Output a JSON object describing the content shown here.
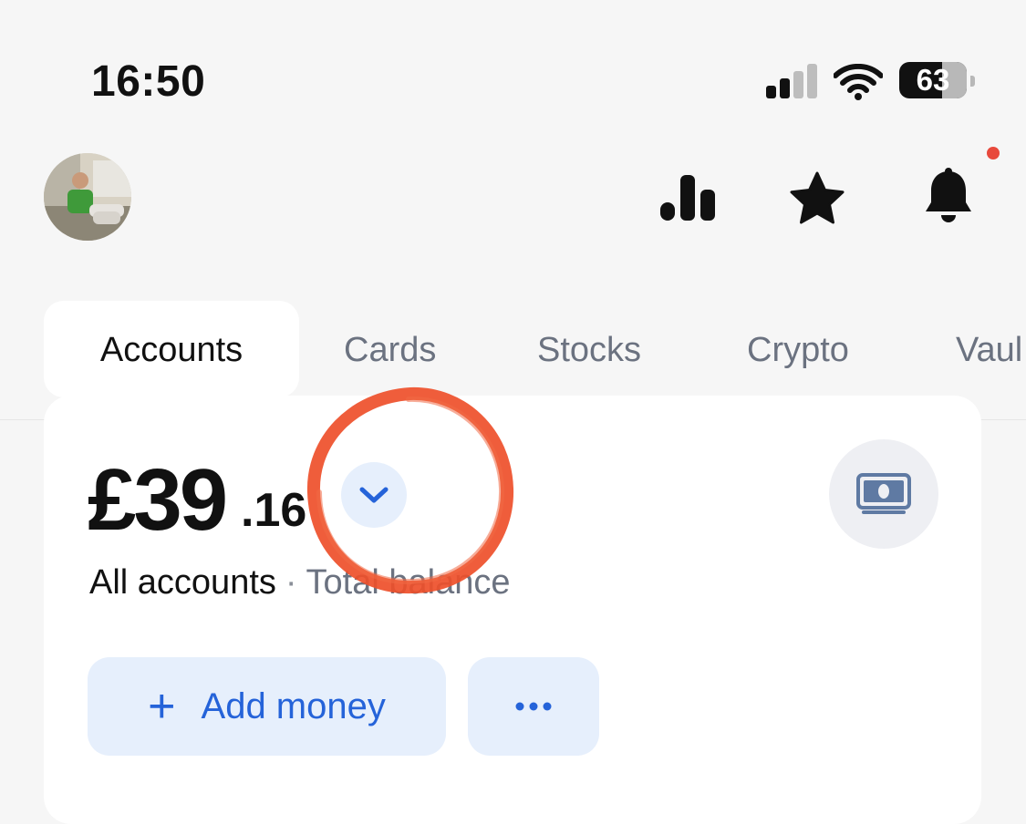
{
  "status_bar": {
    "time": "16:50",
    "battery_level": "63",
    "signal_bars_active": 2,
    "signal_bars_total": 4
  },
  "header": {
    "avatar_icon": "profile-avatar",
    "actions": [
      {
        "icon": "analytics-bars-icon"
      },
      {
        "icon": "star-icon"
      },
      {
        "icon": "bell-icon",
        "has_notification": true
      }
    ]
  },
  "tabs": [
    {
      "label": "Accounts",
      "active": true
    },
    {
      "label": "Cards",
      "active": false
    },
    {
      "label": "Stocks",
      "active": false
    },
    {
      "label": "Crypto",
      "active": false
    },
    {
      "label": "Vaul",
      "active": false
    }
  ],
  "balance": {
    "integer": "£39",
    "decimal": ".16",
    "accounts_label": "All accounts",
    "separator": "·",
    "total_label": "Total balance"
  },
  "buttons": {
    "add_money_plus": "+",
    "add_money_label": "Add money",
    "more_icon": "ellipsis-icon",
    "accounts_switch_icon": "chevron-down-icon",
    "cash_icon": "banknote-icon"
  },
  "colors": {
    "accent": "#2563d9",
    "button_bg": "#e6effc",
    "notification": "#e8493c",
    "annotation_circle": "#ee4f2a"
  }
}
